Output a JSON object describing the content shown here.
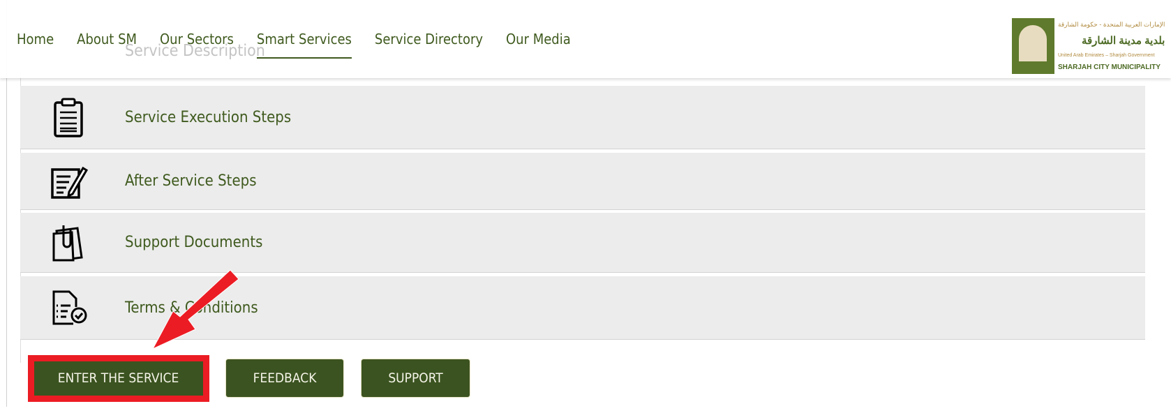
{
  "nav": {
    "items": [
      {
        "label": "Home"
      },
      {
        "label": "About SM"
      },
      {
        "label": "Our Sectors"
      },
      {
        "label": "Smart Services",
        "active": true
      },
      {
        "label": "Service Directory"
      },
      {
        "label": "Our Media"
      }
    ]
  },
  "logo": {
    "ar_line1": "الإمارات العربية المتحدة - حكومة الشارقة",
    "ar_line2": "بلدية مدينة الشارقة",
    "en_line1": "United Arab Emirates – Sharjah Government",
    "en_line2": "SHARJAH CITY MUNICIPALITY"
  },
  "ghost_section": {
    "label": "Service Description",
    "icon": "stopwatch-wrench-icon"
  },
  "sections": [
    {
      "label": "Service Execution Steps",
      "icon": "clipboard-icon"
    },
    {
      "label": "After Service Steps",
      "icon": "document-pen-icon"
    },
    {
      "label": "Support Documents",
      "icon": "paperclip-documents-icon"
    },
    {
      "label": "Terms & Conditions",
      "icon": "checklist-icon"
    }
  ],
  "buttons": {
    "enter": "ENTER THE SERVICE",
    "feedback": "FEEDBACK",
    "support": "SUPPORT"
  },
  "colors": {
    "brand": "#3b5320",
    "text": "#3f5a1e",
    "highlight": "#ec1c24",
    "row_bg": "#ececec"
  }
}
